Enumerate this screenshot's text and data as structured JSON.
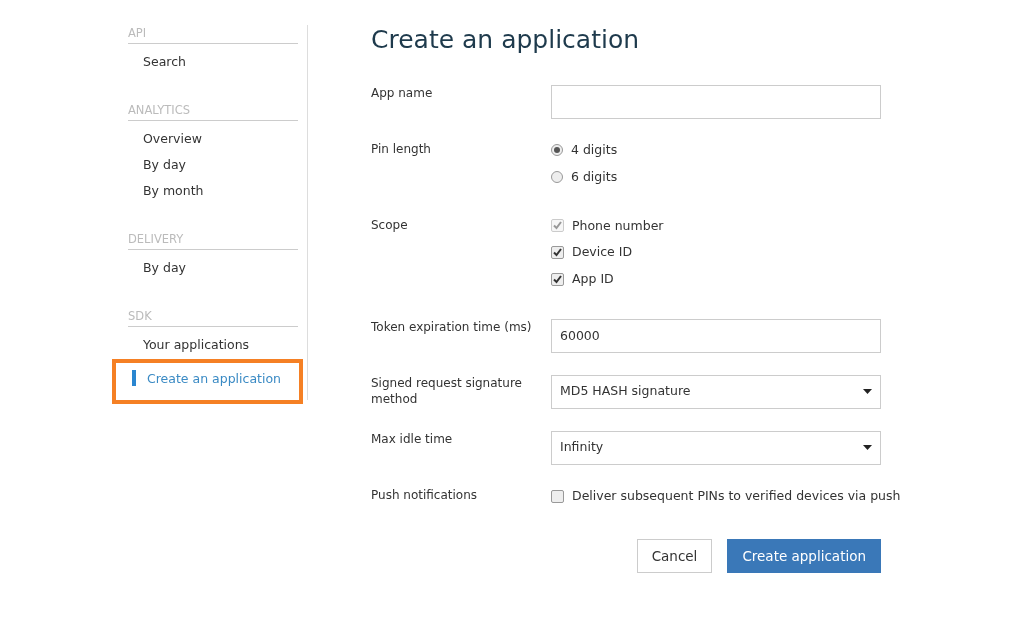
{
  "sidebar": {
    "sections": [
      {
        "heading": "API",
        "items": [
          {
            "label": "Search",
            "selected": false,
            "highlighted": false
          }
        ]
      },
      {
        "heading": "ANALYTICS",
        "items": [
          {
            "label": "Overview",
            "selected": false,
            "highlighted": false
          },
          {
            "label": "By day",
            "selected": false,
            "highlighted": false
          },
          {
            "label": "By month",
            "selected": false,
            "highlighted": false
          }
        ]
      },
      {
        "heading": "DELIVERY",
        "items": [
          {
            "label": "By day",
            "selected": false,
            "highlighted": false
          }
        ]
      },
      {
        "heading": "SDK",
        "items": [
          {
            "label": "Your applications",
            "selected": false,
            "highlighted": false
          },
          {
            "label": "Create an application",
            "selected": true,
            "highlighted": true
          }
        ]
      }
    ]
  },
  "form": {
    "title": "Create an application",
    "fields": [
      {
        "kind": "text",
        "label": "App name"
      },
      {
        "kind": "radio",
        "label": "Pin length",
        "options": [
          {
            "label": "4 digits",
            "selected": true
          },
          {
            "label": "6 digits",
            "selected": false
          }
        ]
      },
      {
        "kind": "checkbox",
        "label": "Scope",
        "options": [
          {
            "label": "Phone number",
            "checked": true,
            "disabled": true
          },
          {
            "label": "Device ID",
            "checked": true,
            "disabled": false
          },
          {
            "label": "App ID",
            "checked": true,
            "disabled": false
          }
        ]
      },
      {
        "kind": "text",
        "label": "Token expiration time (ms)",
        "value": "60000"
      },
      {
        "kind": "select",
        "label": "Signed request signature method",
        "value": "MD5 HASH signature"
      },
      {
        "kind": "select",
        "label": "Max idle time",
        "value": "Infinity"
      },
      {
        "kind": "checkbox",
        "label": "Push notifications",
        "options": [
          {
            "label": "Deliver subsequent PINs to verified devices via push",
            "checked": false,
            "disabled": false
          }
        ]
      }
    ],
    "buttons": [
      {
        "label": "Cancel",
        "kind": "secondary"
      },
      {
        "label": "Create application",
        "kind": "primary"
      }
    ]
  }
}
